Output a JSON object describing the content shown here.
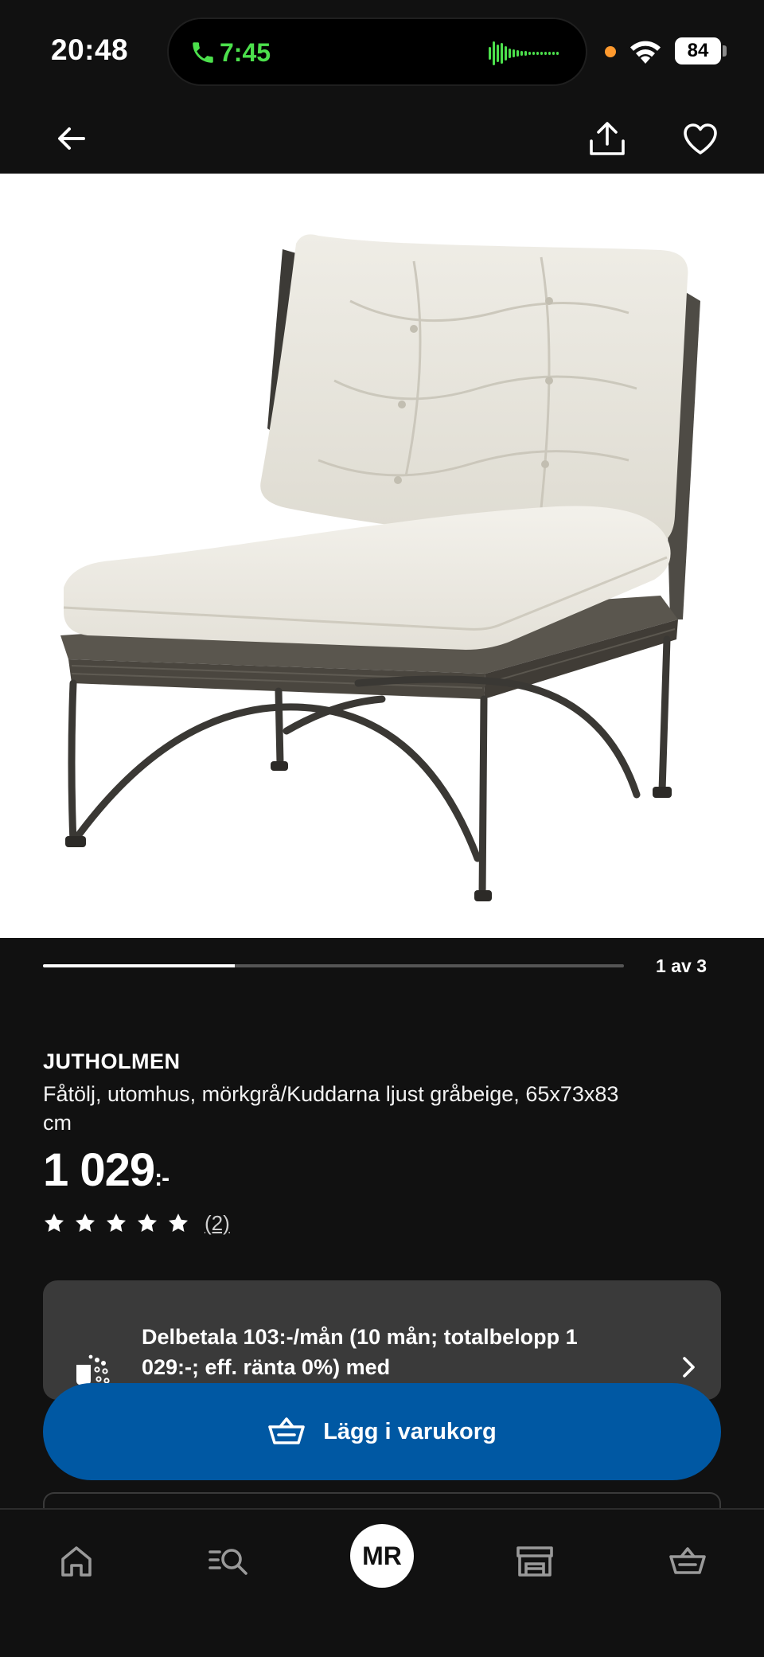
{
  "status_bar": {
    "time": "20:48",
    "call_time": "7:45",
    "battery": "84"
  },
  "top_nav": {
    "back_icon": "arrow-left-icon",
    "share_icon": "share-icon",
    "favorite_icon": "heart-icon"
  },
  "gallery": {
    "position_label": "1 av 3",
    "progress_fraction": 0.33
  },
  "product": {
    "name": "JUTHOLMEN",
    "description": "Fåtölj, utomhus, mörkgrå/Kuddarna ljust gråbeige, 65x73x83 cm",
    "price": "1 029",
    "price_suffix": ":-",
    "rating": 5,
    "rating_max": 5,
    "review_count": "(2)"
  },
  "payment": {
    "text": "Delbetala 103:-/mån (10 mån; totalbelopp 1 029:-; eff. ränta 0%) med"
  },
  "cart_button": {
    "label": "Lägg i varukorg"
  },
  "tab_bar": {
    "items": [
      {
        "icon": "home-icon"
      },
      {
        "icon": "search-list-icon"
      },
      {
        "avatar": "MR"
      },
      {
        "icon": "store-icon"
      },
      {
        "icon": "basket-icon"
      }
    ]
  },
  "colors": {
    "background": "#111111",
    "accent_blue": "#0058a3",
    "card": "#3a3a3a",
    "call_green": "#4ce04c"
  }
}
